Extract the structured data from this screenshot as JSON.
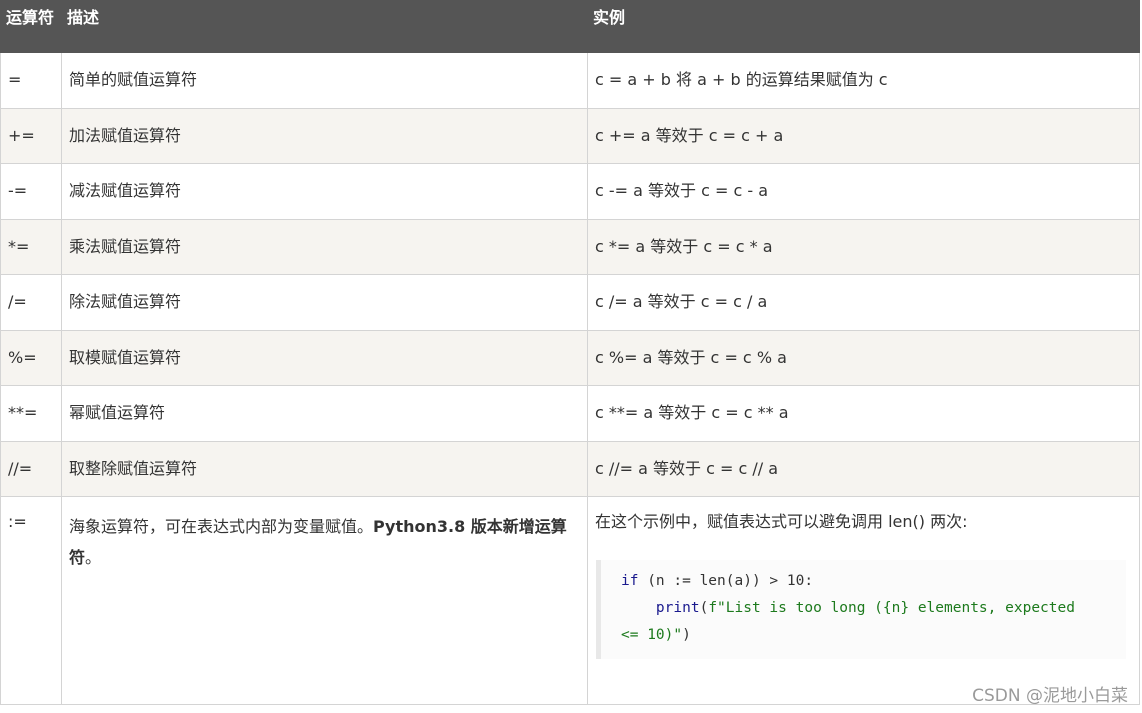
{
  "headers": [
    "运算符",
    "描述",
    "实例"
  ],
  "rows": [
    {
      "op": "=",
      "desc": "简单的赋值运算符",
      "example": "c = a + b 将 a + b 的运算结果赋值为 c"
    },
    {
      "op": "+=",
      "desc": "加法赋值运算符",
      "example": "c += a 等效于 c = c + a"
    },
    {
      "op": "-=",
      "desc": "减法赋值运算符",
      "example": "c -= a 等效于 c = c - a"
    },
    {
      "op": "*=",
      "desc": "乘法赋值运算符",
      "example": "c *= a 等效于 c = c * a"
    },
    {
      "op": "/=",
      "desc": "除法赋值运算符",
      "example": "c /= a 等效于 c = c / a"
    },
    {
      "op": "%=",
      "desc": "取模赋值运算符",
      "example": "c %= a 等效于 c = c % a"
    },
    {
      "op": "**=",
      "desc": "幂赋值运算符",
      "example": "c **= a 等效于 c = c ** a"
    },
    {
      "op": "//=",
      "desc": "取整除赋值运算符",
      "example": "c //= a 等效于 c = c // a"
    }
  ],
  "walrus": {
    "op": ":=",
    "desc_plain": "海象运算符，可在表达式内部为变量赋值。",
    "desc_bold": "Python3.8 版本新增运算符",
    "desc_end": "。",
    "example_intro": "在这个示例中，赋值表达式可以避免调用 len() 两次:",
    "code": {
      "line1_kw": "if",
      "line1_rest": " (n := len(a)) > 10:",
      "line2_fn": "    print",
      "line2_open": "(",
      "line2_str": "f\"List is too long ({n} elements, expected",
      "line3_str": "<= 10)\"",
      "line3_close": ")"
    }
  },
  "watermark": "CSDN @泥地小白菜"
}
